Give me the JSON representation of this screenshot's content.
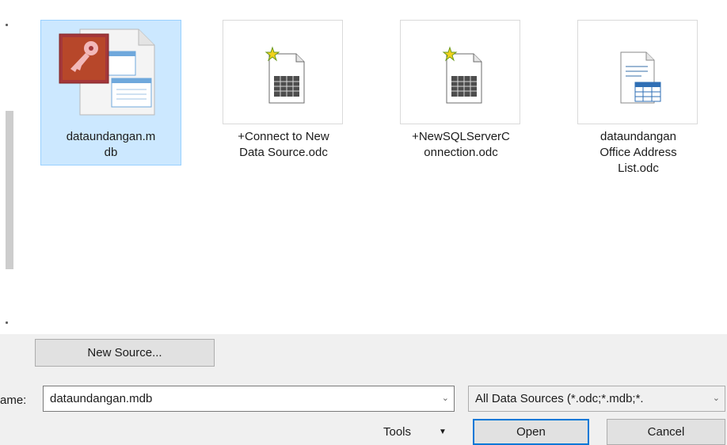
{
  "files": [
    {
      "label": "dataundangan.m\ndb",
      "icon": "access-database-icon",
      "selected": true
    },
    {
      "label": "+Connect to New\nData Source.odc",
      "icon": "odc-new-connection-icon",
      "selected": false
    },
    {
      "label": "+NewSQLServerC\nonnection.odc",
      "icon": "odc-new-connection-icon",
      "selected": false
    },
    {
      "label": "dataundangan\nOffice Address\nList.odc",
      "icon": "office-address-list-icon",
      "selected": false
    }
  ],
  "new_source_label": "New Source...",
  "filename": {
    "label": "ame:",
    "value": "dataundangan.mdb"
  },
  "filter": {
    "value": "All Data Sources (*.odc;*.mdb;*."
  },
  "tools_label": "Tools",
  "open_label": "Open",
  "cancel_label": "Cancel",
  "colors": {
    "selection": "#cce8ff",
    "primary_border": "#0078d7",
    "access_red": "#a4373a"
  }
}
